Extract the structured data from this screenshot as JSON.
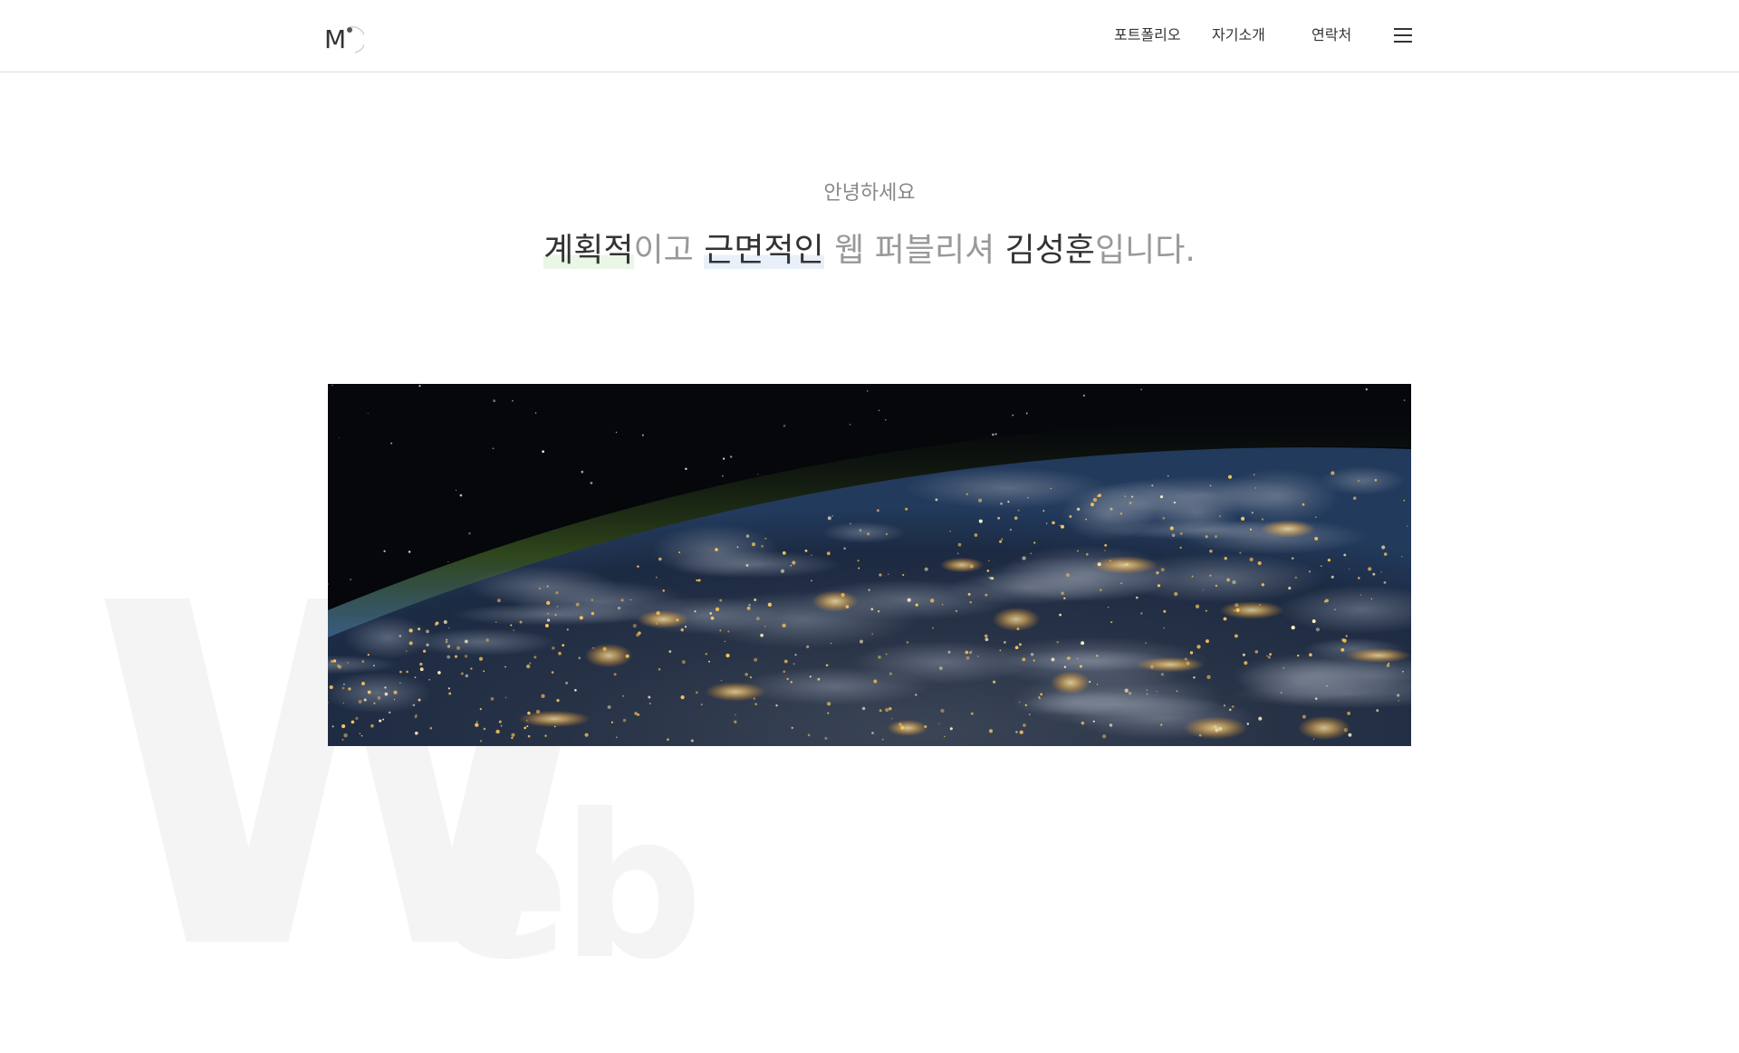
{
  "header": {
    "logo": {
      "letter": "M",
      "icon": "logo-m-icon"
    },
    "nav": [
      {
        "label": "포트폴리오"
      },
      {
        "label": "자기소개"
      },
      {
        "label": "연락처"
      }
    ],
    "menu_icon": "hamburger-menu-icon"
  },
  "intro": {
    "greeting": "안녕하세요",
    "headline": {
      "w1": "계획적",
      "w2": "이고 ",
      "w3": "근면적인",
      "w4": " 웹 퍼블리셔 ",
      "w5": "김성훈",
      "w6": "입니다."
    }
  },
  "hero": {
    "image_subject": "earth-at-night-from-space"
  },
  "watermark": {
    "big": "W",
    "small": "eb"
  },
  "colors": {
    "text_dark": "#333333",
    "text_muted": "#999999",
    "highlight_green": "#eaf6e6",
    "highlight_blue": "#e9f0fa",
    "watermark": "#f4f4f4",
    "border": "#dddddd"
  }
}
